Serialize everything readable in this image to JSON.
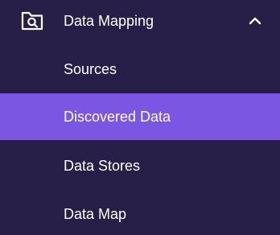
{
  "colors": {
    "background": "#281f48",
    "active_background": "#7a56e2",
    "text": "#ffffff"
  },
  "section": {
    "title": "Data Mapping",
    "icon": "folder-search-icon",
    "expanded": true,
    "toggle_icon": "chevron-up-icon"
  },
  "items": [
    {
      "label": "Sources",
      "active": false
    },
    {
      "label": "Discovered Data",
      "active": true
    },
    {
      "label": "Data Stores",
      "active": false
    },
    {
      "label": "Data Map",
      "active": false
    }
  ]
}
